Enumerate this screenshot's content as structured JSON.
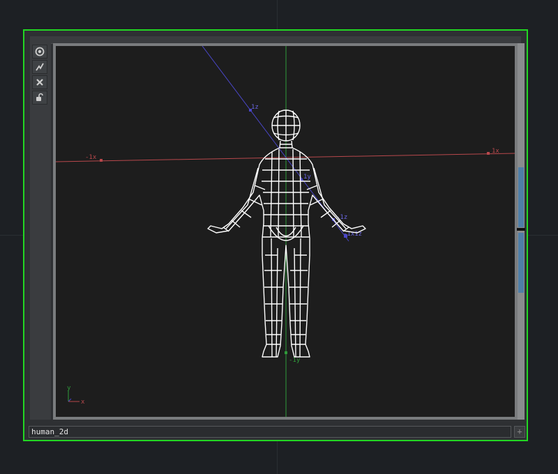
{
  "node": {
    "name": "human_2d",
    "accent_color": "#22d623"
  },
  "toolbar": {
    "buttons": [
      {
        "icon": "viewer-icon"
      },
      {
        "icon": "wire-icon"
      },
      {
        "icon": "close-icon"
      },
      {
        "icon": "lock-icon"
      }
    ]
  },
  "viewport": {
    "axis_labels": {
      "neg_x": "-1x",
      "pos_x": "1x",
      "pos_z": "1z",
      "neg_z": "-1z",
      "neg_y": "-1y",
      "mid": "1y",
      "cluster": "-1x1z"
    },
    "gizmo": {
      "x": "x",
      "y": "y"
    },
    "colors": {
      "x_axis": "#b8484c",
      "y_axis": "#2f9a3a",
      "z_axis": "#4a46c8",
      "mesh": "#ffffff"
    }
  },
  "add_button": {
    "label": "+"
  }
}
